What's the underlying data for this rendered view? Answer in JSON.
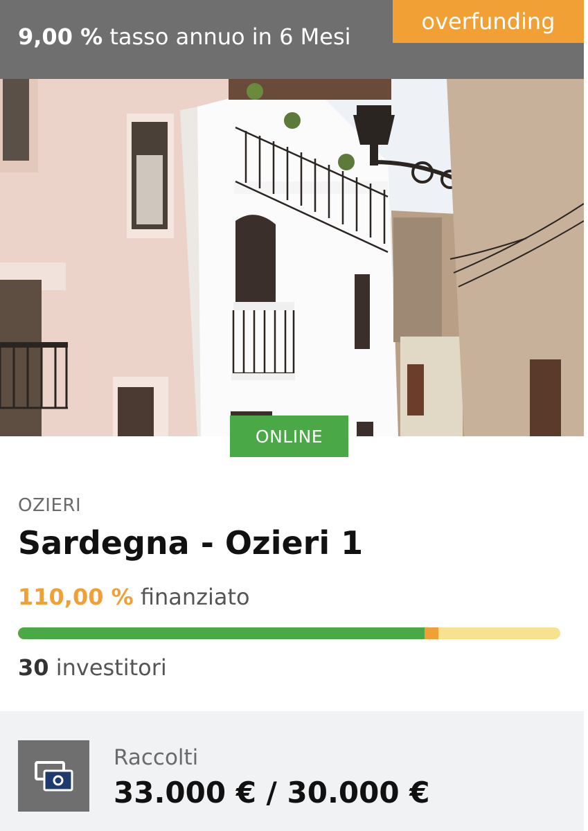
{
  "header": {
    "rate_value": "9,00 %",
    "rate_text": "tasso annuo in 6 Mesi",
    "badge": "overfunding",
    "badge_color": "#f0a035",
    "bar_color": "#6f6f6f"
  },
  "status_badge": "ONLINE",
  "project": {
    "city": "OZIERI",
    "title": "Sardegna - Ozieri 1",
    "funded_pct": "110,00 %",
    "funded_label": "finanziato",
    "progress": {
      "funded_fraction": 1.1,
      "target_fraction": 1.0
    },
    "investors_count": "30",
    "investors_label": "investitori"
  },
  "summary": {
    "icon": "money-icon",
    "raised_label": "Raccolti",
    "raised_value": "33.000 € / 30.000 €"
  },
  "colors": {
    "accent_orange": "#f0a035",
    "success_green": "#4aa847",
    "remaining_yellow": "#f7e38f"
  }
}
